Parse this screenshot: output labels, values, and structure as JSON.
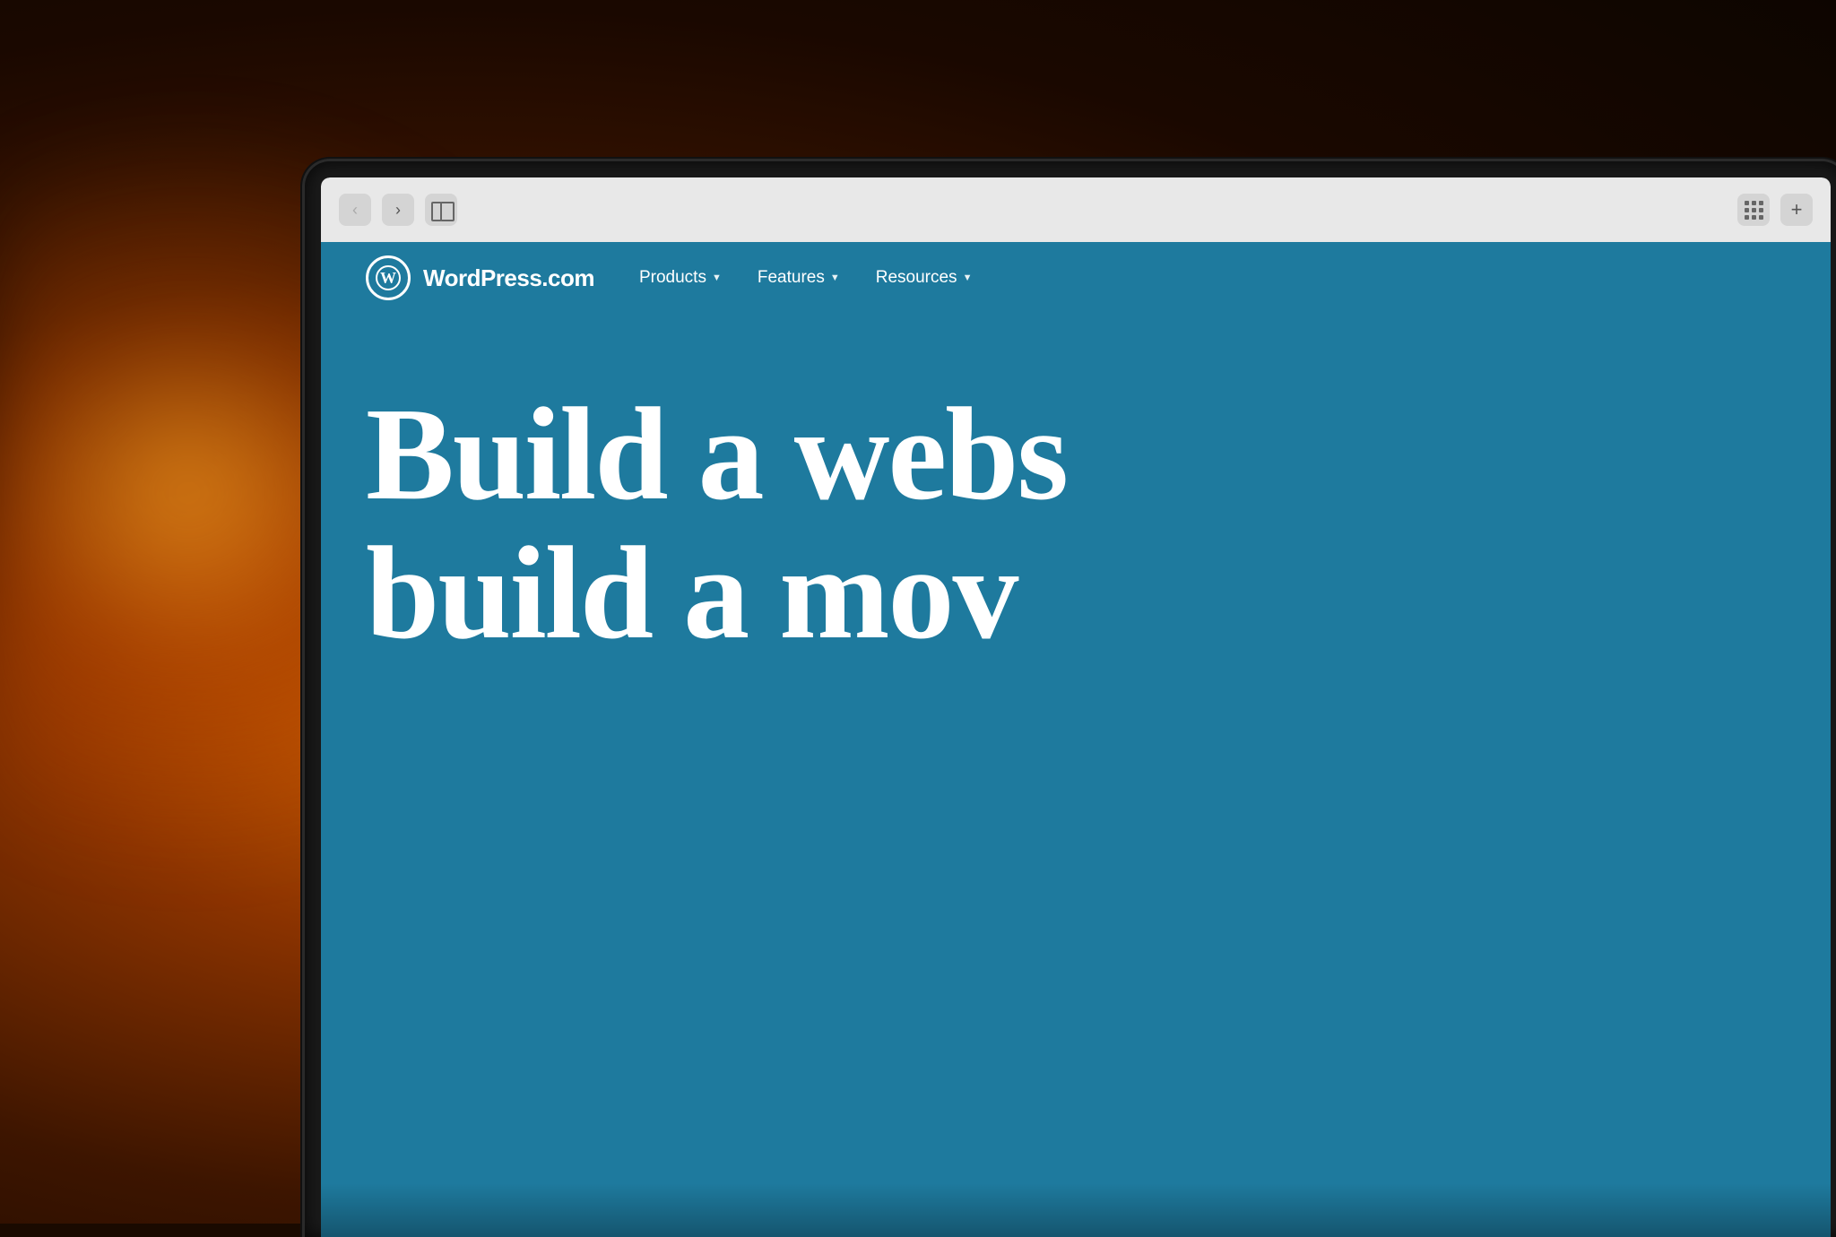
{
  "background": {
    "description": "Warm bokeh background photo with orange/amber light source"
  },
  "device": {
    "type": "laptop",
    "frame_color": "#1a1a1a"
  },
  "browser": {
    "back_button_label": "‹",
    "forward_button_label": "›",
    "sidebar_icon_label": "sidebar",
    "grid_icon_label": "grid",
    "add_tab_label": "+"
  },
  "website": {
    "url": "https://wordpress.com",
    "navbar": {
      "logo_text": "WordPress.com",
      "logo_symbol": "W",
      "nav_items": [
        {
          "label": "Products",
          "has_dropdown": true
        },
        {
          "label": "Features",
          "has_dropdown": true
        },
        {
          "label": "Resources",
          "has_dropdown": true
        }
      ]
    },
    "hero": {
      "title_line1": "Build a webs",
      "title_line2": "build a mov"
    },
    "background_color": "#1e7a9e"
  }
}
